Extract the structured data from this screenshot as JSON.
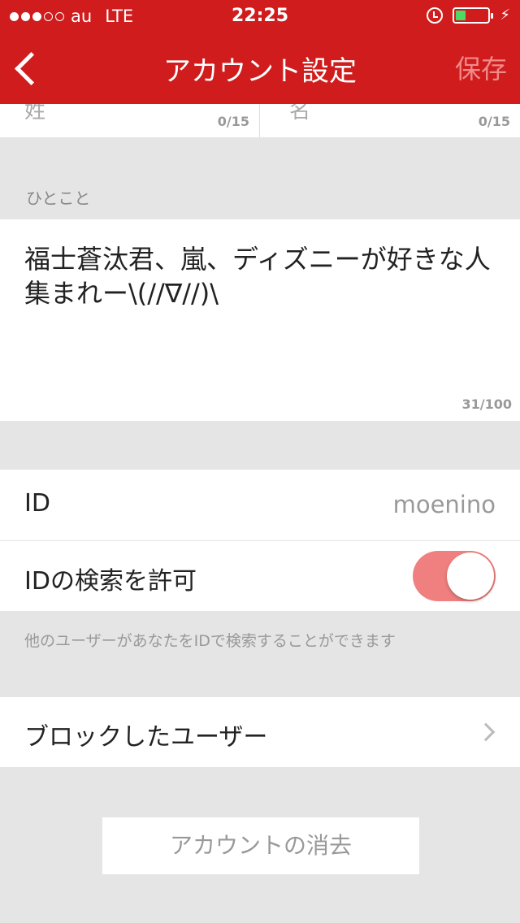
{
  "status_bar": {
    "signal_full": 3,
    "signal_total": 5,
    "carrier": "au",
    "network": "LTE",
    "time": "22:25",
    "battery_level": 0.3,
    "battery_color": "#4cd964"
  },
  "nav": {
    "title": "アカウント設定",
    "save_label": "保存",
    "back_icon": "chevron-left-icon",
    "background": "#d01c1c"
  },
  "name_fields": {
    "last_name_label": "姓",
    "first_name_label": "名",
    "last_name_count": "0/15",
    "first_name_count": "0/15"
  },
  "bio": {
    "section_label": "ひとこと",
    "text": "福士蒼汰君、嵐、ディズニーが好きな人集まれー\\(//∇//)\\",
    "count": "31/100"
  },
  "id_row": {
    "label": "ID",
    "value": "moenino"
  },
  "search_permission": {
    "label": "IDの検索を許可",
    "enabled": true,
    "hint": "他のユーザーがあなたをIDで検索することができます"
  },
  "blocked": {
    "label": "ブロックしたユーザー"
  },
  "delete_account": {
    "label": "アカウントの消去"
  }
}
